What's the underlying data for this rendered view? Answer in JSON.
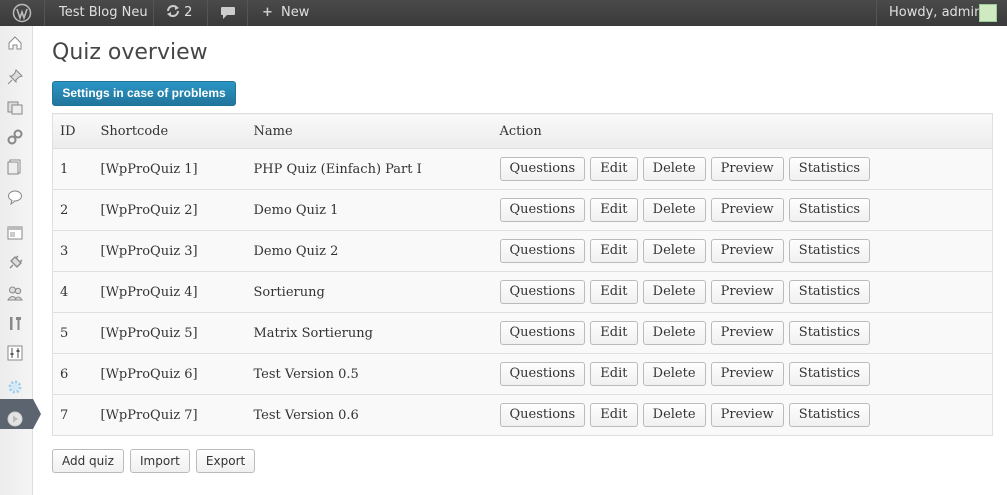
{
  "admin_bar": {
    "site_name": "Test Blog Neu",
    "updates_count": "2",
    "new_label": "New",
    "account_label": "Howdy, admin",
    "icons": {
      "wp": "wordpress-logo-icon",
      "updates": "refresh-icon",
      "comments": "comment-icon",
      "new": "plus-icon"
    }
  },
  "admin_menu": {
    "icons": [
      "dashboard-icon",
      "posts-pin-icon",
      "media-icon",
      "links-icon",
      "pages-icon",
      "comments-icon",
      "appearance-icon",
      "plugins-icon",
      "users-icon",
      "tools-icon",
      "settings-icon",
      "quiz-gear-icon",
      "collapse-icon"
    ],
    "current": "quiz-gear-icon"
  },
  "page": {
    "title": "Quiz overview",
    "settings_button": "Settings in case of problems"
  },
  "table": {
    "headers": {
      "id": "ID",
      "shortcode": "Shortcode",
      "name": "Name",
      "action": "Action"
    },
    "action_labels": {
      "questions": "Questions",
      "edit": "Edit",
      "delete": "Delete",
      "preview": "Preview",
      "statistics": "Statistics"
    },
    "rows": [
      {
        "id": "1",
        "shortcode": "[WpProQuiz 1]",
        "name": "PHP Quiz (Einfach) Part I"
      },
      {
        "id": "2",
        "shortcode": "[WpProQuiz 2]",
        "name": "Demo Quiz 1"
      },
      {
        "id": "3",
        "shortcode": "[WpProQuiz 3]",
        "name": "Demo Quiz 2"
      },
      {
        "id": "4",
        "shortcode": "[WpProQuiz 4]",
        "name": "Sortierung"
      },
      {
        "id": "5",
        "shortcode": "[WpProQuiz 5]",
        "name": "Matrix Sortierung"
      },
      {
        "id": "6",
        "shortcode": "[WpProQuiz 6]",
        "name": "Test Version 0.5"
      },
      {
        "id": "7",
        "shortcode": "[WpProQuiz 7]",
        "name": "Test Version 0.6"
      }
    ]
  },
  "footer_buttons": {
    "add": "Add quiz",
    "import": "Import",
    "export": "Export"
  },
  "colors": {
    "admin_bar": "#464646",
    "primary": "#21759b",
    "menu_current": "#5c6470"
  }
}
